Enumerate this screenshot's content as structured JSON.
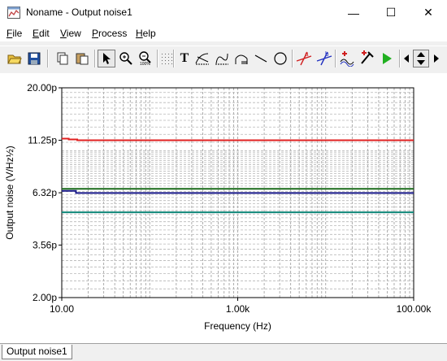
{
  "window": {
    "title": "Noname - Output noise1",
    "minimize_glyph": "—",
    "maximize_glyph": "☐",
    "close_glyph": "✕"
  },
  "menu": [
    {
      "underline": "F",
      "rest": "ile"
    },
    {
      "underline": "E",
      "rest": "dit"
    },
    {
      "underline": "V",
      "rest": "iew"
    },
    {
      "underline": "P",
      "rest": "rocess"
    },
    {
      "underline": "H",
      "rest": "elp"
    }
  ],
  "toolbar": {
    "icons": [
      "open-folder-icon",
      "save-disk-icon",
      "copy-icon",
      "paste-icon",
      "pointer-icon",
      "zoom-in-icon",
      "zoom-100-icon",
      "grid-icon",
      "text-tool-icon",
      "tangent-icon",
      "curve-icon",
      "axis-icon",
      "line-tool-icon",
      "circle-tool-icon",
      "cursor-a-icon",
      "cursor-b-icon",
      "add-curve-icon",
      "pipette-icon",
      "run-icon",
      "arrow-left-icon",
      "arrow-up-down-icon",
      "arrow-right-icon"
    ],
    "text_tool_glyph": "T",
    "cursor_a_label": "a",
    "cursor_b_label": "b"
  },
  "statusbar": {
    "tab_label": "Output noise1"
  },
  "chart_data": {
    "type": "line",
    "xlabel": "Frequency (Hz)",
    "ylabel": "Output noise (V/Hz½)",
    "xscale": "log",
    "yscale": "log",
    "xlim": [
      10,
      100000
    ],
    "ylim": [
      2.0,
      20.0
    ],
    "y_unit": "p",
    "x_ticks": [
      "10.00",
      "1.00k",
      "100.00k"
    ],
    "y_ticks": [
      "20.00p",
      "11.25p",
      "6.32p",
      "3.56p",
      "2.00p"
    ],
    "grid": true,
    "series": [
      {
        "color": "#e02020",
        "x": [
          10,
          12,
          15,
          100000
        ],
        "y": [
          11.45,
          11.35,
          11.25,
          11.25
        ]
      },
      {
        "color": "#1a6a1a",
        "x": [
          10,
          100000
        ],
        "y": [
          6.6,
          6.6
        ]
      },
      {
        "color": "#1a1a8a",
        "x": [
          10,
          14,
          14.5,
          100000
        ],
        "y": [
          6.45,
          6.45,
          6.3,
          6.3
        ]
      },
      {
        "color": "#10887a",
        "x": [
          10,
          100000
        ],
        "y": [
          5.1,
          5.1
        ]
      }
    ]
  }
}
